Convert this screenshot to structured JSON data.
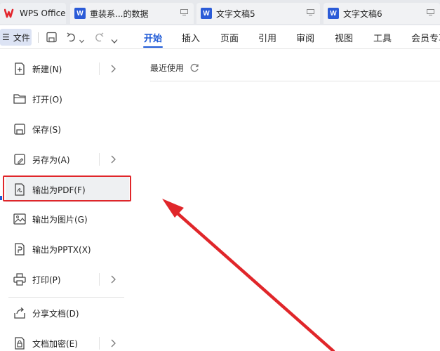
{
  "tabs": [
    {
      "label": "WPS Office",
      "type": "home"
    },
    {
      "label": "重装系...的数据",
      "type": "doc"
    },
    {
      "label": "文字文稿5",
      "type": "doc"
    },
    {
      "label": "文字文稿6",
      "type": "doc"
    }
  ],
  "toolbar": {
    "file_label": "文件",
    "menus": [
      "开始",
      "插入",
      "页面",
      "引用",
      "审阅",
      "视图",
      "工具",
      "会员专享"
    ],
    "active_menu": "开始"
  },
  "sidebar": {
    "items": [
      {
        "label": "新建(N)",
        "icon": "new-doc-icon",
        "has_submenu": true
      },
      {
        "label": "打开(O)",
        "icon": "folder-icon",
        "has_submenu": false
      },
      {
        "label": "保存(S)",
        "icon": "save-icon",
        "has_submenu": false
      },
      {
        "label": "另存为(A)",
        "icon": "save-as-icon",
        "has_submenu": true
      },
      {
        "label": "输出为PDF(F)",
        "icon": "export-pdf-icon",
        "has_submenu": false
      },
      {
        "label": "输出为图片(G)",
        "icon": "export-image-icon",
        "has_submenu": false
      },
      {
        "label": "输出为PPTX(X)",
        "icon": "export-pptx-icon",
        "has_submenu": false
      },
      {
        "label": "打印(P)",
        "icon": "printer-icon",
        "has_submenu": true
      },
      {
        "label": "分享文档(D)",
        "icon": "share-icon",
        "has_submenu": false
      },
      {
        "label": "文档加密(E)",
        "icon": "encrypt-icon",
        "has_submenu": true
      }
    ]
  },
  "main": {
    "recent_label": "最近使用"
  },
  "colors": {
    "accent": "#1d59d6",
    "highlight": "#e0262a",
    "wps_red": "#e3262d"
  }
}
